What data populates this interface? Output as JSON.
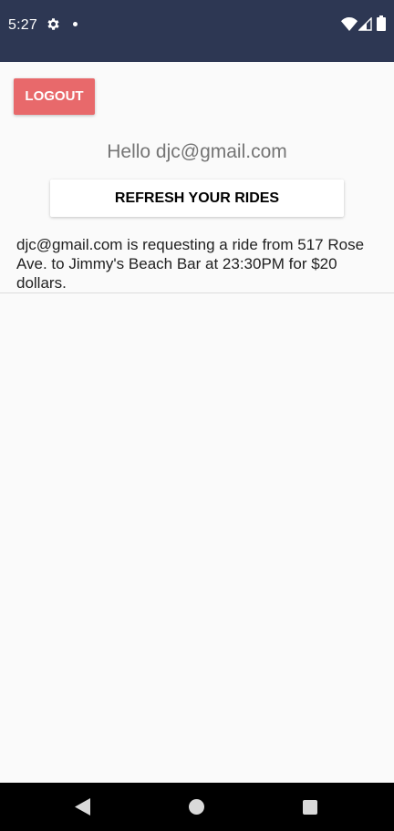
{
  "status_bar": {
    "time": "5:27",
    "background_color": "#2d3753",
    "icons": [
      "gear-icon",
      "notification-dot-icon",
      "wifi-icon",
      "cell-signal-icon",
      "battery-icon"
    ]
  },
  "header": {
    "logout_label": "LOGOUT",
    "logout_color": "#e8696b"
  },
  "main": {
    "greeting": "Hello djc@gmail.com",
    "refresh_label": "REFRESH YOUR RIDES",
    "rides": [
      {
        "text": "djc@gmail.com is requesting a ride from 517 Rose Ave. to Jimmy's Beach Bar at 23:30PM for $20 dollars."
      }
    ]
  },
  "nav_bar": {
    "icons": [
      "back-icon",
      "home-icon",
      "recents-icon"
    ]
  }
}
